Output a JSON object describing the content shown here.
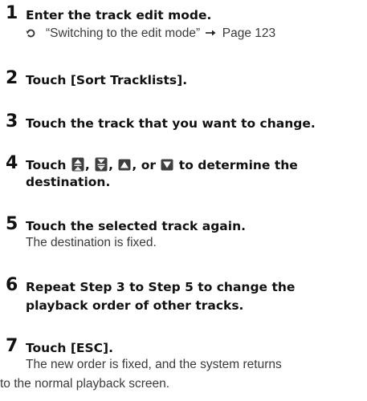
{
  "steps": [
    {
      "number": "1",
      "title": "Enter the track edit mode.",
      "reference": {
        "text": "“Switching to the edit mode”",
        "page": "Page 123",
        "hook_icon": "reference-hook-icon",
        "arrow_icon": "right-arrow-icon"
      }
    },
    {
      "number": "2",
      "title": "Touch [Sort Tracklists]."
    },
    {
      "number": "3",
      "title": "Touch the track that you want to change."
    },
    {
      "number": "4",
      "title_parts": [
        "Touch ",
        ", ",
        ", ",
        ", or ",
        " to determine the"
      ],
      "title_line2": "destination.",
      "icons": [
        "move-to-top-icon",
        "move-to-bottom-icon",
        "move-up-icon",
        "move-down-icon"
      ]
    },
    {
      "number": "5",
      "title": "Touch the selected track again.",
      "description": "The destination is fixed."
    },
    {
      "number": "6",
      "title_line1": "Repeat Step 3 to Step 5 to change the",
      "title_line2": "playback order of other tracks."
    },
    {
      "number": "7",
      "title": "Touch [ESC].",
      "description_line1": "The new order is fixed, and the system returns",
      "description_line2": "to the normal playback screen."
    }
  ],
  "colors": {
    "heading": "#111111",
    "body": "#3a3a3a",
    "icon_fill": "#3f3f3f"
  }
}
